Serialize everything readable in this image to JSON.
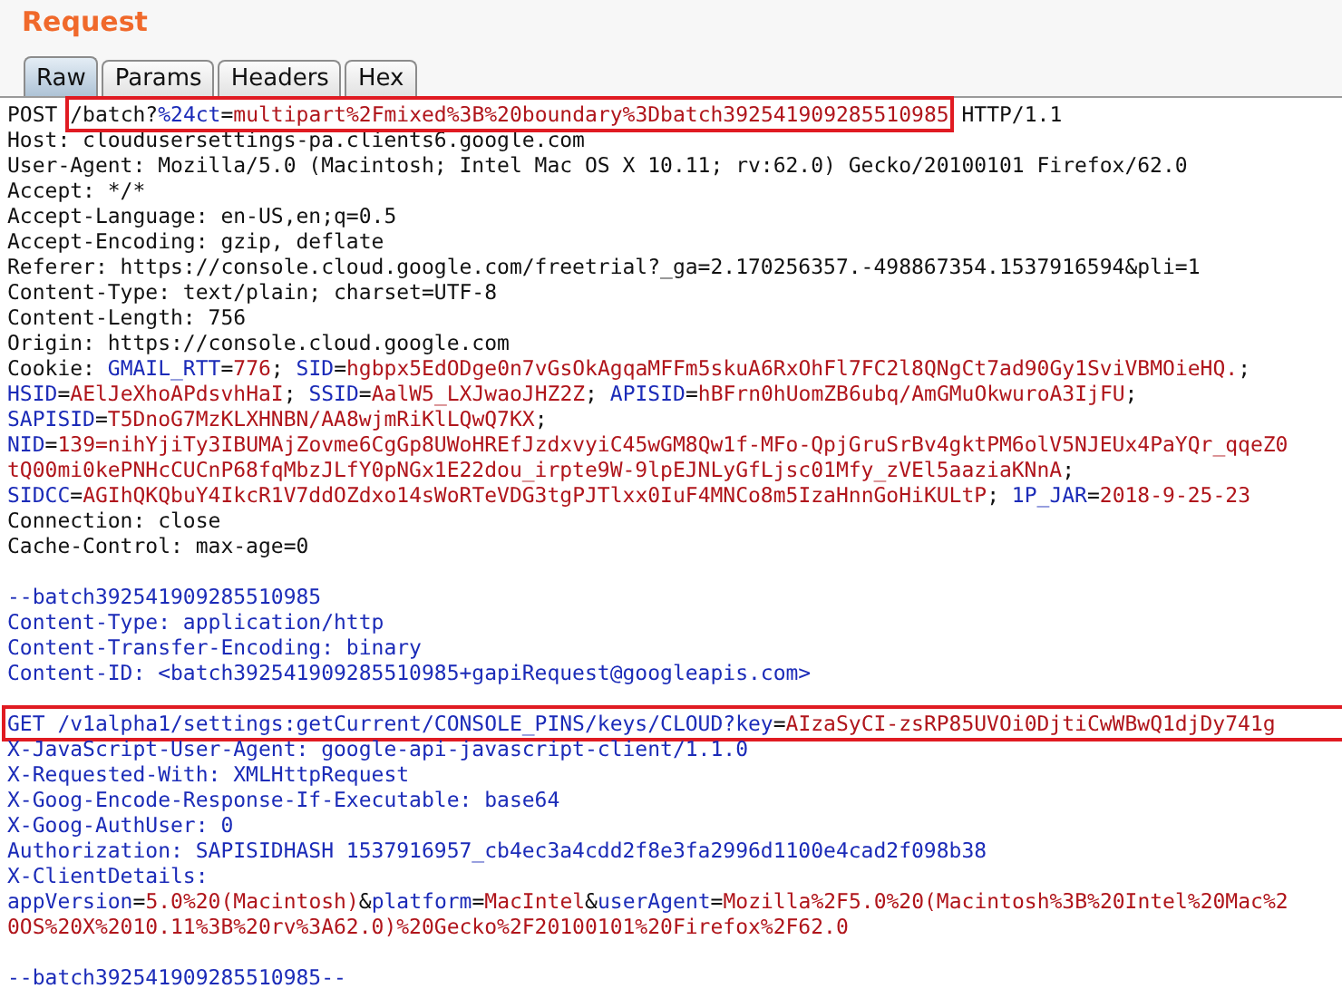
{
  "panel": {
    "title": "Request"
  },
  "tabs": [
    {
      "label": "Raw",
      "selected": true
    },
    {
      "label": "Params",
      "selected": false
    },
    {
      "label": "Headers",
      "selected": false
    },
    {
      "label": "Hex",
      "selected": false
    }
  ],
  "lines": [
    {
      "kind": "text",
      "parts": [
        {
          "kind": "plain",
          "text": "POST "
        },
        {
          "kind": "box",
          "parts": [
            {
              "kind": "plain",
              "text": "/batch?"
            },
            {
              "kind": "name",
              "text": "%24ct"
            },
            {
              "kind": "plain",
              "text": "="
            },
            {
              "kind": "value",
              "text": "multipart%2Fmixed%3B%20boundary%3Dbatch392541909285510985"
            }
          ]
        },
        {
          "kind": "plain",
          "text": " HTTP/1.1"
        }
      ]
    },
    {
      "kind": "text",
      "parts": [
        {
          "kind": "plain",
          "text": "Host: cloudusersettings-pa.clients6.google.com"
        }
      ]
    },
    {
      "kind": "text",
      "parts": [
        {
          "kind": "plain",
          "text": "User-Agent: Mozilla/5.0 (Macintosh; Intel Mac OS X 10.11; rv:62.0) Gecko/20100101 Firefox/62.0"
        }
      ]
    },
    {
      "kind": "text",
      "parts": [
        {
          "kind": "plain",
          "text": "Accept: */*"
        }
      ]
    },
    {
      "kind": "text",
      "parts": [
        {
          "kind": "plain",
          "text": "Accept-Language: en-US,en;q=0.5"
        }
      ]
    },
    {
      "kind": "text",
      "parts": [
        {
          "kind": "plain",
          "text": "Accept-Encoding: gzip, deflate"
        }
      ]
    },
    {
      "kind": "text",
      "parts": [
        {
          "kind": "plain",
          "text": "Referer: https://console.cloud.google.com/freetrial?_ga=2.170256357.-498867354.1537916594&pli=1"
        }
      ]
    },
    {
      "kind": "text",
      "parts": [
        {
          "kind": "plain",
          "text": "Content-Type: text/plain; charset=UTF-8"
        }
      ]
    },
    {
      "kind": "text",
      "parts": [
        {
          "kind": "plain",
          "text": "Content-Length: 756"
        }
      ]
    },
    {
      "kind": "text",
      "parts": [
        {
          "kind": "plain",
          "text": "Origin: https://console.cloud.google.com"
        }
      ]
    },
    {
      "kind": "text",
      "parts": [
        {
          "kind": "plain",
          "text": "Cookie: "
        },
        {
          "kind": "name",
          "text": "GMAIL_RTT"
        },
        {
          "kind": "plain",
          "text": "="
        },
        {
          "kind": "value",
          "text": "776"
        },
        {
          "kind": "plain",
          "text": "; "
        },
        {
          "kind": "name",
          "text": "SID"
        },
        {
          "kind": "plain",
          "text": "="
        },
        {
          "kind": "value",
          "text": "hgbpx5EdODge0n7vGsOkAgqaMFFm5skuA6RxOhFl7FC2l8QNgCt7ad90Gy1SviVBMOieHQ."
        },
        {
          "kind": "plain",
          "text": ";"
        }
      ]
    },
    {
      "kind": "text",
      "parts": [
        {
          "kind": "name",
          "text": "HSID"
        },
        {
          "kind": "plain",
          "text": "="
        },
        {
          "kind": "value",
          "text": "AElJeXhoAPdsvhHaI"
        },
        {
          "kind": "plain",
          "text": "; "
        },
        {
          "kind": "name",
          "text": "SSID"
        },
        {
          "kind": "plain",
          "text": "="
        },
        {
          "kind": "value",
          "text": "AalW5_LXJwaoJHZ2Z"
        },
        {
          "kind": "plain",
          "text": "; "
        },
        {
          "kind": "name",
          "text": "APISID"
        },
        {
          "kind": "plain",
          "text": "="
        },
        {
          "kind": "value",
          "text": "hBFrn0hUomZB6ubq/AmGMuOkwuroA3IjFU"
        },
        {
          "kind": "plain",
          "text": ";"
        }
      ]
    },
    {
      "kind": "text",
      "parts": [
        {
          "kind": "name",
          "text": "SAPISID"
        },
        {
          "kind": "plain",
          "text": "="
        },
        {
          "kind": "value",
          "text": "T5DnoG7MzKLXHNBN/AA8wjmRiKlLQwQ7KX"
        },
        {
          "kind": "plain",
          "text": ";"
        }
      ]
    },
    {
      "kind": "text",
      "parts": [
        {
          "kind": "name",
          "text": "NID"
        },
        {
          "kind": "plain",
          "text": "="
        },
        {
          "kind": "value",
          "text": "139=nihYjiTy3IBUMAjZovme6CgGp8UWoHREfJzdxvyiC45wGM8Qw1f-MFo-QpjGruSrBv4gktPM6olV5NJEUx4PaYQr_qqeZ0"
        }
      ]
    },
    {
      "kind": "text",
      "parts": [
        {
          "kind": "value",
          "text": "tQ00mi0kePNHcCUCnP68fqMbzJLfY0pNGx1E22dou_irpte9W-9lpEJNLyGfLjsc01Mfy_zVEl5aaziaKNnA"
        },
        {
          "kind": "plain",
          "text": ";"
        }
      ]
    },
    {
      "kind": "text",
      "parts": [
        {
          "kind": "name",
          "text": "SIDCC"
        },
        {
          "kind": "plain",
          "text": "="
        },
        {
          "kind": "value",
          "text": "AGIhQKQbuY4IkcR1V7ddOZdxo14sWoRTeVDG3tgPJTlxx0IuF4MNCo8m5IzaHnnGoHiKULtP"
        },
        {
          "kind": "plain",
          "text": "; "
        },
        {
          "kind": "name",
          "text": "1P_JAR"
        },
        {
          "kind": "plain",
          "text": "="
        },
        {
          "kind": "value",
          "text": "2018-9-25-23"
        }
      ]
    },
    {
      "kind": "text",
      "parts": [
        {
          "kind": "plain",
          "text": "Connection: close"
        }
      ]
    },
    {
      "kind": "text",
      "parts": [
        {
          "kind": "plain",
          "text": "Cache-Control: max-age=0"
        }
      ]
    },
    {
      "kind": "blank"
    },
    {
      "kind": "text",
      "parts": [
        {
          "kind": "name",
          "text": "--batch392541909285510985"
        }
      ]
    },
    {
      "kind": "text",
      "parts": [
        {
          "kind": "name",
          "text": "Content-Type: application/http"
        }
      ]
    },
    {
      "kind": "text",
      "parts": [
        {
          "kind": "name",
          "text": "Content-Transfer-Encoding: binary"
        }
      ]
    },
    {
      "kind": "text",
      "parts": [
        {
          "kind": "name",
          "text": "Content-ID: <batch392541909285510985+gapiRequest@googleapis.com>"
        }
      ]
    },
    {
      "kind": "blank"
    },
    {
      "kind": "text",
      "parts": [
        {
          "kind": "box",
          "parts": [
            {
              "kind": "name",
              "text": "GET /v1alpha1/settings:getCurrent/CONSOLE_PINS/keys/CLOUD?key"
            },
            {
              "kind": "plain",
              "text": "="
            },
            {
              "kind": "value",
              "text": "AIzaSyCI-zsRP85UVOi0DjtiCwWBwQ1djDy741g"
            }
          ]
        }
      ]
    },
    {
      "kind": "text",
      "parts": [
        {
          "kind": "name",
          "text": "X-JavaScript-User-Agent: google-api-javascript-client/1.1.0"
        }
      ]
    },
    {
      "kind": "text",
      "parts": [
        {
          "kind": "name",
          "text": "X-Requested-With: XMLHttpRequest"
        }
      ]
    },
    {
      "kind": "text",
      "parts": [
        {
          "kind": "name",
          "text": "X-Goog-Encode-Response-If-Executable: base64"
        }
      ]
    },
    {
      "kind": "text",
      "parts": [
        {
          "kind": "name",
          "text": "X-Goog-AuthUser: 0"
        }
      ]
    },
    {
      "kind": "text",
      "parts": [
        {
          "kind": "name",
          "text": "Authorization: SAPISIDHASH 1537916957_cb4ec3a4cdd2f8e3fa2996d1100e4cad2f098b38"
        }
      ]
    },
    {
      "kind": "text",
      "parts": [
        {
          "kind": "name",
          "text": "X-ClientDetails:"
        }
      ]
    },
    {
      "kind": "text",
      "parts": [
        {
          "kind": "name",
          "text": "appVersion"
        },
        {
          "kind": "plain",
          "text": "="
        },
        {
          "kind": "value",
          "text": "5.0%20(Macintosh)"
        },
        {
          "kind": "plain",
          "text": "&"
        },
        {
          "kind": "name",
          "text": "platform"
        },
        {
          "kind": "plain",
          "text": "="
        },
        {
          "kind": "value",
          "text": "MacIntel"
        },
        {
          "kind": "plain",
          "text": "&"
        },
        {
          "kind": "name",
          "text": "userAgent"
        },
        {
          "kind": "plain",
          "text": "="
        },
        {
          "kind": "value",
          "text": "Mozilla%2F5.0%20(Macintosh%3B%20Intel%20Mac%2"
        }
      ]
    },
    {
      "kind": "text",
      "parts": [
        {
          "kind": "value",
          "text": "0OS%20X%2010.11%3B%20rv%3A62.0)%20Gecko%2F20100101%20Firefox%2F62.0"
        }
      ]
    },
    {
      "kind": "blank"
    },
    {
      "kind": "text",
      "parts": [
        {
          "kind": "name",
          "text": "--batch392541909285510985--"
        }
      ]
    }
  ]
}
